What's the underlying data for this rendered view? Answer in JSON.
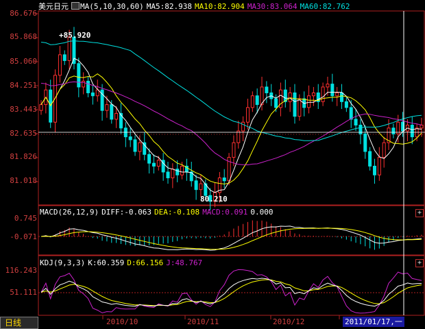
{
  "colors": {
    "up": "#ff3030",
    "down": "#00e0e0",
    "axis": "#d24040",
    "ma5": "#ffffff",
    "ma10": "#ffff00",
    "ma30": "#cc22cc",
    "ma60": "#00e0e0",
    "diff": "#ffffff",
    "dea": "#ffff00",
    "macd": "#cc22cc",
    "k": "#ffffff",
    "d": "#ffff00",
    "j": "#cc22cc"
  },
  "main_panel": {
    "symbol": "美元日元",
    "ma_label": "MA(5,10,30,60)",
    "ma5": "MA5:82.938",
    "ma10": "MA10:82.904",
    "ma30": "MA30:83.064",
    "ma60": "MA60:82.762",
    "y_ticks": [
      "86.676",
      "85.868",
      "85.060",
      "84.251",
      "83.443",
      "82.635",
      "81.826",
      "81.018"
    ],
    "high_label": "+85.920",
    "low_label": "80.210"
  },
  "macd_panel": {
    "label": "MACD(26,12,9)",
    "diff": "DIFF:-0.063",
    "dea": "DEA:-0.108",
    "macd": "MACD:0.091",
    "extra": "0.000",
    "y_ticks": [
      "0.745",
      "-0.071"
    ]
  },
  "kdj_panel": {
    "label": "KDJ(9,3,3)",
    "k": "K:60.359",
    "d": "D:66.156",
    "j": "J:48.767",
    "y_ticks": [
      "116.243",
      "51.111"
    ]
  },
  "x_axis": {
    "labels": [
      "2010/10",
      "2010/11",
      "2010/12"
    ]
  },
  "footer": {
    "period_button": "日线",
    "cursor_date": "2011/01/17,一"
  },
  "panel_buttons": [
    "+",
    "+"
  ],
  "chart_data": {
    "type": "candlestick",
    "ylim": [
      80.2,
      86.7
    ],
    "closes": [
      83.6,
      84.1,
      83.0,
      84.6,
      85.3,
      85.1,
      85.9,
      85.0,
      84.2,
      84.4,
      84.0,
      83.9,
      84.1,
      83.4,
      83.6,
      83.1,
      83.3,
      82.8,
      82.5,
      82.4,
      82.0,
      82.3,
      81.9,
      81.6,
      81.5,
      81.7,
      81.3,
      81.1,
      81.4,
      81.2,
      81.5,
      81.3,
      81.0,
      80.7,
      80.9,
      80.5,
      80.3,
      80.6,
      81.1,
      81.0,
      81.8,
      82.3,
      82.7,
      83.0,
      83.5,
      83.9,
      83.6,
      84.2,
      84.0,
      83.8,
      83.5,
      84.1,
      83.7,
      84.0,
      83.2,
      83.8,
      83.5,
      83.9,
      84.0,
      83.7,
      84.2,
      84.3,
      83.9,
      84.0,
      83.7,
      83.5,
      83.1,
      82.9,
      82.6,
      82.0,
      81.5,
      81.2,
      81.8,
      82.3,
      82.8,
      82.6,
      83.0,
      82.7,
      82.9,
      82.5,
      82.8,
      82.9
    ]
  }
}
